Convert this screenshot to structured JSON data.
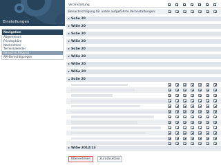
{
  "sidebar": {
    "title": "Einstellungen",
    "nav_heading": "Navigation",
    "items": [
      {
        "label": "Allgemeines",
        "active": false
      },
      {
        "label": "Privatsphäre",
        "active": false
      },
      {
        "label": "Nachrichten",
        "active": false
      },
      {
        "label": "Terminkalender",
        "active": false
      },
      {
        "label": "Benachrichtigung",
        "active": true
      },
      {
        "label": "API-Berechtigungen",
        "active": false
      }
    ]
  },
  "main": {
    "column_header": "Veranstaltung",
    "notify_unlisted_label": "Benachrichtigung für unten aufgeführte Veranstaltungen:",
    "semesters_top": [
      {
        "label": "SoSe 20"
      },
      {
        "label": "WiSe 20"
      },
      {
        "label": "SoSe 20"
      },
      {
        "label": "WiSe 20"
      },
      {
        "label": "SoSe 20"
      },
      {
        "label": "WiSe 20"
      },
      {
        "label": "WiSe 20"
      }
    ],
    "open_semester": {
      "label": "SoSe 20"
    },
    "bottom_semester": {
      "label": "WiSe 2012/13"
    }
  },
  "buttons": {
    "apply_label": "Übernehmen",
    "reset_label": "Zurücksetzen"
  },
  "colors": {
    "banner": "#27435c",
    "active_nav": "#899cb0",
    "semester_row": "#dfe5eb",
    "apply_border": "#d9534f"
  }
}
